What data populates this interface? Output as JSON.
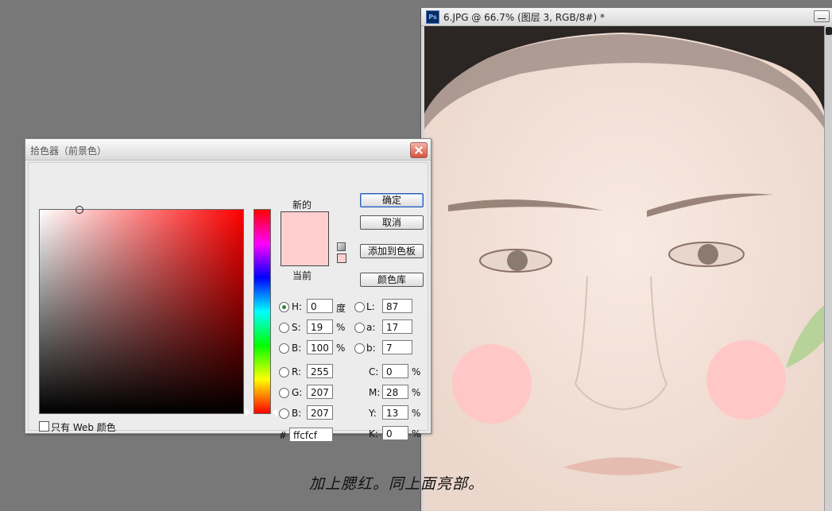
{
  "document": {
    "title": "6.JPG @ 66.7% (图层 3, RGB/8#) *",
    "app_icon": "Ps",
    "zoom": "66.7%"
  },
  "color_picker": {
    "title": "拾色器（前景色）",
    "new_label": "新的",
    "current_label": "当前",
    "new_color": "#ffcfcf",
    "current_color": "#ffcfcf",
    "buttons": {
      "ok": "确定",
      "cancel": "取消",
      "add_swatch": "添加到色板",
      "libraries": "颜色库"
    },
    "hsb": [
      {
        "label": "H:",
        "value": "0",
        "unit": "度",
        "selected": true
      },
      {
        "label": "S:",
        "value": "19",
        "unit": "%",
        "selected": false
      },
      {
        "label": "B:",
        "value": "100",
        "unit": "%",
        "selected": false
      }
    ],
    "rgb": [
      {
        "label": "R:",
        "value": "255"
      },
      {
        "label": "G:",
        "value": "207"
      },
      {
        "label": "B:",
        "value": "207"
      }
    ],
    "lab": [
      {
        "label": "L:",
        "value": "87"
      },
      {
        "label": "a:",
        "value": "17"
      },
      {
        "label": "b:",
        "value": "7"
      }
    ],
    "cmyk": [
      {
        "label": "C:",
        "value": "0",
        "unit": "%"
      },
      {
        "label": "M:",
        "value": "28",
        "unit": "%"
      },
      {
        "label": "Y:",
        "value": "13",
        "unit": "%"
      },
      {
        "label": "K:",
        "value": "0",
        "unit": "%"
      }
    ],
    "hex_label": "#",
    "hex_value": "ffcfcf",
    "web_only_label": "只有 Web 颜色",
    "web_only_checked": false
  },
  "caption": "加上腮红。同上面亮部。",
  "colors": {
    "blush": "#ffc6c6",
    "skin": "#f3e3da",
    "dialog_bg": "#ececec"
  },
  "icons": [
    "ps-app-icon",
    "close-icon",
    "minimize-icon",
    "gamut-warning-icon"
  ]
}
